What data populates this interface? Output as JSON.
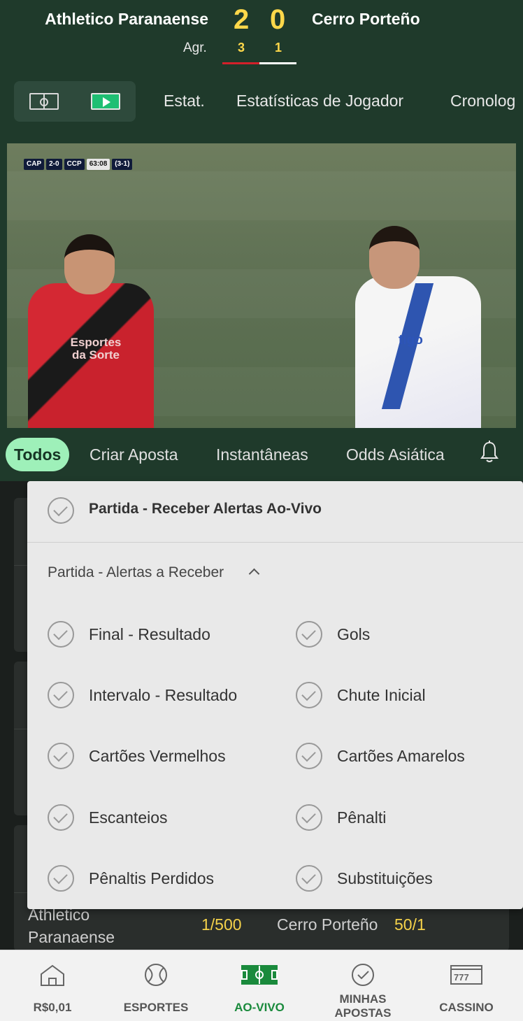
{
  "match": {
    "home_team": "Athletico Paranaense",
    "away_team": "Cerro Porteño",
    "home_score": "2",
    "away_score": "0",
    "agg_label": "Agr.",
    "home_agg": "3",
    "away_agg": "1",
    "home_share": 0.5
  },
  "topnav": {
    "items": [
      "Estat.",
      "Estatísticas de Jogador",
      "Cronolog"
    ]
  },
  "video": {
    "scorebug": {
      "home": "CAP",
      "score": "2-0",
      "away": "CCP",
      "clock": "63:08",
      "agg": "(3-1)"
    },
    "home_shirt_text": "Esportes da Sorte",
    "away_shirt_text": "tigo"
  },
  "filter_tabs": {
    "items": [
      "Todos",
      "Criar Aposta",
      "Instantâneas",
      "Odds Asiática"
    ],
    "active": "Todos"
  },
  "alerts_panel": {
    "title": "Partida - Receber Alertas Ao-Vivo",
    "section_label": "Partida - Alertas a Receber",
    "options": [
      "Final - Resultado",
      "Gols",
      "Intervalo - Resultado",
      "Chute Inicial",
      "Cartões Vermelhos",
      "Cartões Amarelos",
      "Escanteios",
      "Pênalti",
      "Pênaltis Perdidos",
      "Substituições"
    ]
  },
  "odds_row": {
    "home_team": "Athletico Paranaense",
    "home_odds": "1/500",
    "away_team": "Cerro Porteño",
    "away_odds": "50/1"
  },
  "bottom_nav": {
    "items": [
      {
        "label": "R$0,01",
        "icon": "home-icon"
      },
      {
        "label": "ESPORTES",
        "icon": "ball-icon"
      },
      {
        "label": "AO-VIVO",
        "icon": "live-pitch-icon"
      },
      {
        "label": "MINHAS APOSTAS",
        "icon": "check-circle-icon"
      },
      {
        "label": "CASSINO",
        "icon": "slot-machine-icon"
      }
    ],
    "active": "AO-VIVO"
  },
  "colors": {
    "header_bg": "#1f3a2b",
    "score_yellow": "#ffd84a",
    "active_tab_bg": "#9ef0b9",
    "active_nav": "#1a8a3c",
    "panel_bg": "#e9e9e9"
  }
}
